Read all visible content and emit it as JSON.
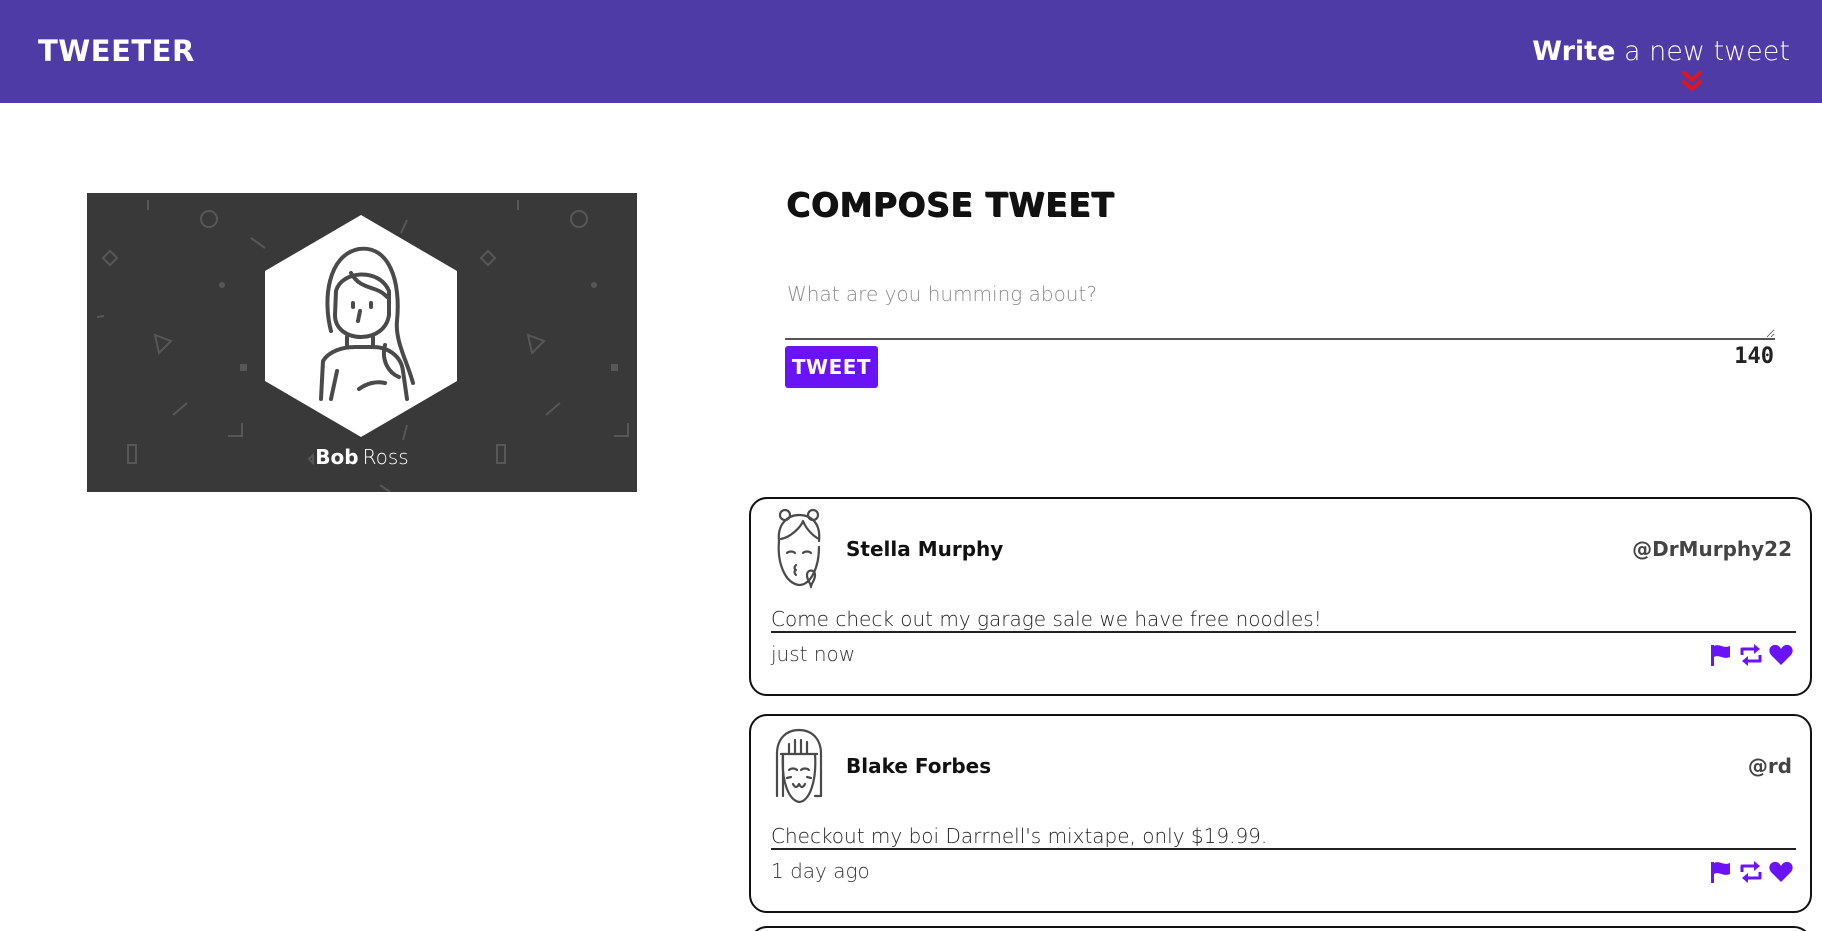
{
  "nav": {
    "brand": "TWEETER",
    "write_strong": "Write",
    "write_rest": "a new tweet",
    "chevron_icon": "double-chevron-down-icon",
    "chevron_color": "#e0141e",
    "bg_color": "#4e3ba6"
  },
  "profile": {
    "first_name": "Bob",
    "last_name": "Ross",
    "avatar_icon": "woman-avatar-icon"
  },
  "compose": {
    "title": "COMPOSE TWEET",
    "placeholder": "What are you humming about?",
    "button_label": "TWEET",
    "counter": "140",
    "accent": "#6a14f5"
  },
  "tweets": [
    {
      "name": "Stella Murphy",
      "handle": "@DrMurphy22",
      "text": "Come check out my garage sale we have free noodles!",
      "time": "just now",
      "avatar_icon": "kissing-face-avatar-icon"
    },
    {
      "name": "Blake Forbes",
      "handle": "@rd",
      "text": "Checkout my boi Darrnell's mixtape, only $19.99.",
      "time": "1 day ago",
      "avatar_icon": "smiling-face-avatar-icon"
    }
  ],
  "action_icons": [
    "flag-icon",
    "retweet-icon",
    "heart-icon"
  ]
}
